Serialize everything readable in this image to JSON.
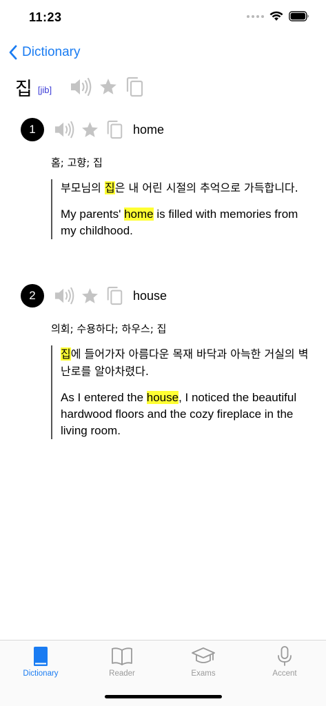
{
  "status": {
    "time": "11:23"
  },
  "nav": {
    "back_label": "Dictionary"
  },
  "entry": {
    "word": "집",
    "romanization": "[jib]"
  },
  "senses": [
    {
      "number": "1",
      "gloss": "home",
      "translations": "홈; 고향; 집",
      "example_ko": {
        "before": "부모님의 ",
        "highlight": "집",
        "after": "은 내 어린 시절의 추억으로 가득합니다."
      },
      "example_en": {
        "before": "My parents' ",
        "highlight": "home",
        "after": " is filled with memories from my childhood."
      }
    },
    {
      "number": "2",
      "gloss": "house",
      "translations": "의회; 수용하다; 하우스; 집",
      "example_ko": {
        "before": "",
        "highlight": "집",
        "after": "에 들어가자 아름다운 목재 바닥과 아늑한 거실의 벽난로를 알아차렸다."
      },
      "example_en": {
        "before": "As I entered the ",
        "highlight": "house",
        "after": ", I noticed the beautiful hardwood floors and the cozy fireplace in the living room."
      }
    }
  ],
  "tabs": [
    {
      "label": "Dictionary",
      "icon": "book-icon",
      "active": true
    },
    {
      "label": "Reader",
      "icon": "open-book-icon",
      "active": false
    },
    {
      "label": "Exams",
      "icon": "graduation-cap-icon",
      "active": false
    },
    {
      "label": "Accent",
      "icon": "microphone-icon",
      "active": false
    }
  ],
  "colors": {
    "accent": "#1a7cf2",
    "highlight": "#ffff33",
    "icon_gray": "#c4c4c4",
    "tab_inactive": "#9a9a9a"
  }
}
